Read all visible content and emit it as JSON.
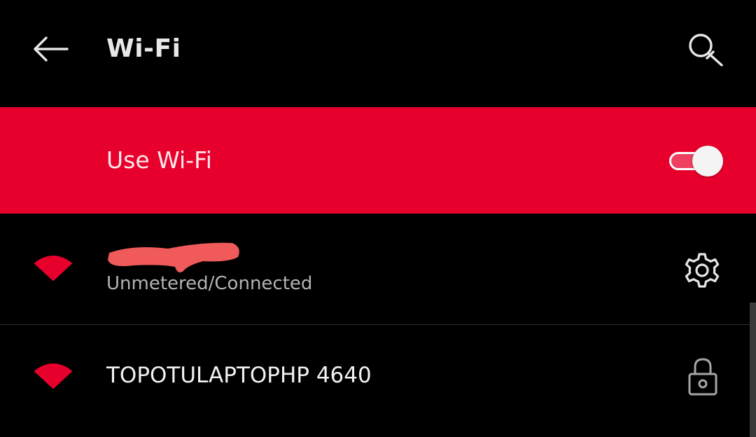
{
  "toolbar": {
    "title": "Wi-Fi",
    "back_icon": "arrow-left-icon",
    "search_icon": "search-icon"
  },
  "master_toggle": {
    "label": "Use Wi-Fi",
    "state": "on"
  },
  "networks": [
    {
      "name": "",
      "name_redacted": true,
      "status": "Unmetered/Connected",
      "signal_icon": "wifi-signal-icon",
      "action_icon": "gear-icon"
    },
    {
      "name": "TOPOTULAPTOPHP 4640",
      "status": "",
      "signal_icon": "wifi-signal-icon",
      "action_icon": "lock-icon"
    }
  ],
  "colors": {
    "accent": "#e8002d",
    "background": "#000000",
    "primary_text": "#f2f2f2",
    "secondary_text": "#b3b3b3",
    "redaction": "#f05a5a"
  }
}
